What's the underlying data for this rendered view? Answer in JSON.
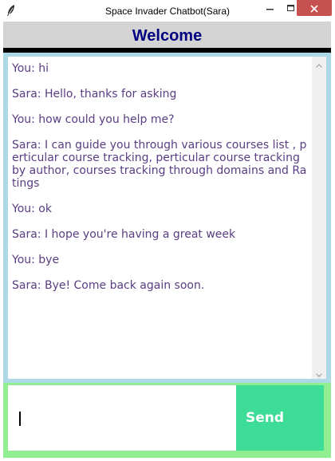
{
  "window": {
    "title": "Space Invader Chatbot(Sara)",
    "app_icon": "feather-icon",
    "controls": {
      "minimize_icon": "minimize-icon",
      "maximize_icon": "maximize-icon",
      "close_icon": "close-icon"
    }
  },
  "header": {
    "title": "Welcome"
  },
  "chat": {
    "messages": [
      "You: hi",
      "Sara: Hello, thanks for asking",
      "You: how could you help me?",
      "Sara: I can guide you through various courses list , perticular course tracking, perticular course tracking by author, courses tracking through domains and Ratings",
      "You: ok",
      "Sara: I hope you're having a great week",
      "You: bye",
      "Sara: Bye! Come back again soon."
    ]
  },
  "input": {
    "value": "",
    "send_label": "Send"
  },
  "colors": {
    "header_bg": "#d4d4d4",
    "header_text": "#000080",
    "chat_frame": "#add8e6",
    "message_text": "#5a3d82",
    "input_frame": "#90ee90",
    "send_button": "#3ddc97",
    "close_button": "#c75050"
  }
}
